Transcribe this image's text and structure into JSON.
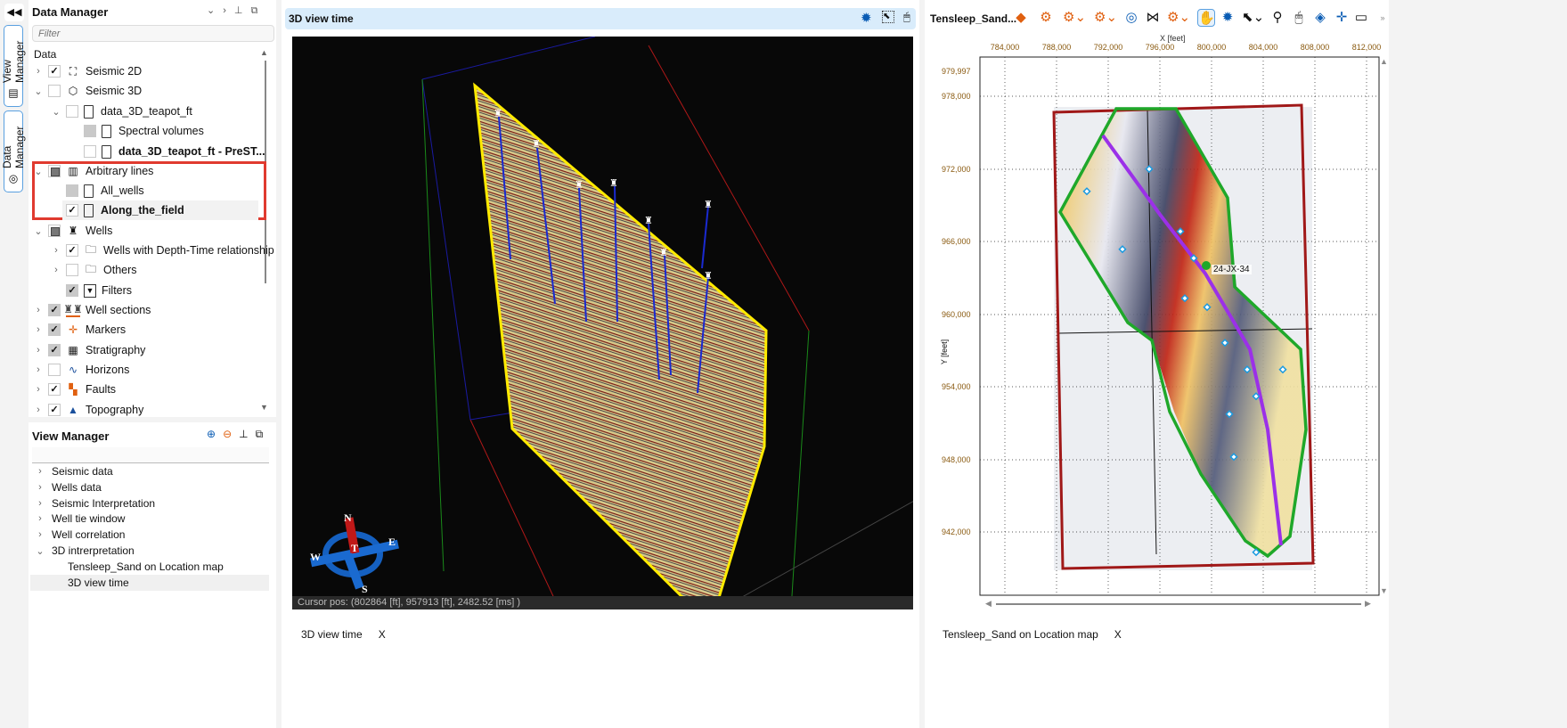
{
  "side_tabs": {
    "view_manager": "View Manager",
    "data_manager": "Data Manager"
  },
  "data_manager": {
    "title": "Data Manager",
    "filter_placeholder": "Filter",
    "header": "Data",
    "items": [
      {
        "label": "Seismic 2D",
        "checked": "✓"
      },
      {
        "label": "Seismic 3D",
        "checked": ""
      },
      {
        "label": "data_3D_teapot_ft",
        "checked": ""
      },
      {
        "label": "Spectral volumes",
        "checked": ""
      },
      {
        "label": "data_3D_teapot_ft - PreST...",
        "checked": ""
      },
      {
        "label": "Arbitrary lines",
        "checked": ""
      },
      {
        "label": "All_wells",
        "checked": ""
      },
      {
        "label": "Along_the_field",
        "checked": "✓"
      },
      {
        "label": "Wells",
        "checked": ""
      },
      {
        "label": "Wells with Depth-Time relationship",
        "checked": "✓"
      },
      {
        "label": "Others",
        "checked": ""
      },
      {
        "label": "Filters",
        "checked": "✓"
      },
      {
        "label": "Well sections",
        "checked": "✓"
      },
      {
        "label": "Markers",
        "checked": "✓"
      },
      {
        "label": "Stratigraphy",
        "checked": "✓"
      },
      {
        "label": "Horizons",
        "checked": ""
      },
      {
        "label": "Faults",
        "checked": "✓"
      },
      {
        "label": "Topography",
        "checked": "✓"
      }
    ]
  },
  "view_manager": {
    "title": "View Manager",
    "items": [
      "Seismic data",
      "Wells data",
      "Seismic Interpretation",
      "Well tie window",
      "Well correlation",
      "3D intrerpretation",
      "Tensleep_Sand on Location map",
      "3D view time"
    ]
  },
  "view3d": {
    "title": "3D view time",
    "cursor_pos": "Cursor pos: (802864 [ft], 957913 [ft], 2482.52 [ms] )",
    "compass": {
      "n": "N",
      "s": "S",
      "e": "E",
      "w": "W",
      "t": "T"
    },
    "tab_label": "3D view time",
    "tab_close": "X"
  },
  "map": {
    "title": "Tensleep_Sand...",
    "x_axis_label": "X [feet]",
    "y_axis_label": "Y [feet]",
    "x_ticks": [
      "784,000",
      "788,000",
      "792,000",
      "796,000",
      "800,000",
      "804,000",
      "808,000",
      "812,000"
    ],
    "y_ticks": [
      "979,997",
      "978,000",
      "972,000",
      "966,000",
      "960,000",
      "954,000",
      "948,000",
      "942,000"
    ],
    "well_label": "24-JX-34",
    "tab_label": "Tensleep_Sand on Location map",
    "tab_close": "X"
  },
  "colors": {
    "accent": "#0a5cb4",
    "highlight": "#e03a2f",
    "header_bg": "#d9ecfb",
    "boundary": "#a01818",
    "outline": "#1fa82a",
    "line": "#9b30e8"
  }
}
